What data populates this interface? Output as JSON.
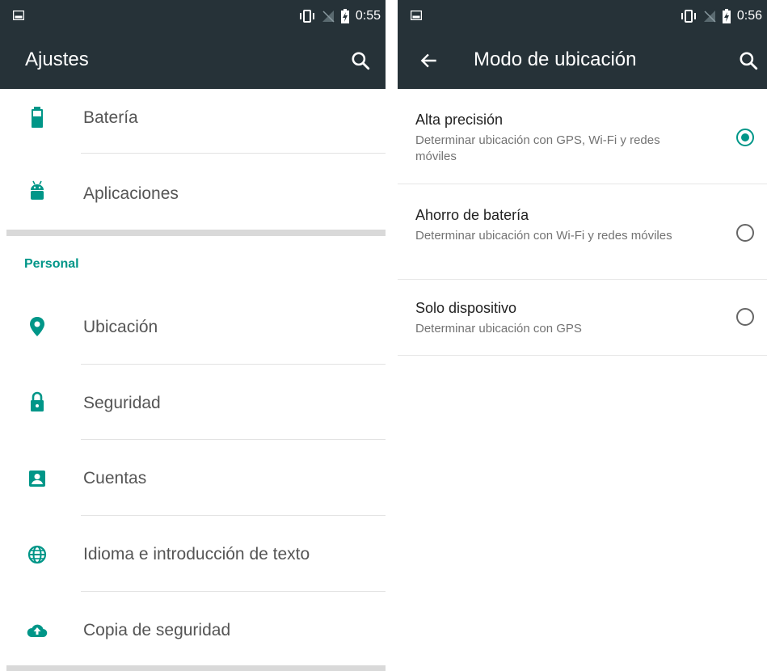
{
  "colors": {
    "toolbar": "#263238",
    "accent": "#009688",
    "icon": "#009688"
  },
  "left": {
    "status": {
      "time": "0:55"
    },
    "toolbar": {
      "title": "Ajustes",
      "search_icon": "search-icon"
    },
    "items_top": [
      {
        "label": "Batería",
        "icon": "battery-icon"
      },
      {
        "label": "Aplicaciones",
        "icon": "android-icon"
      }
    ],
    "section_header": "Personal",
    "items_personal": [
      {
        "label": "Ubicación",
        "icon": "location-pin-icon"
      },
      {
        "label": "Seguridad",
        "icon": "lock-icon"
      },
      {
        "label": "Cuentas",
        "icon": "account-box-icon"
      },
      {
        "label": "Idioma e introducción de texto",
        "icon": "globe-icon"
      },
      {
        "label": "Copia de seguridad",
        "icon": "cloud-upload-icon"
      }
    ]
  },
  "right": {
    "status": {
      "time": "0:56"
    },
    "toolbar": {
      "title": "Modo de ubicación",
      "back_icon": "arrow-back-icon",
      "search_icon": "search-icon"
    },
    "options": [
      {
        "title": "Alta precisión",
        "subtitle": "Determinar ubicación con GPS, Wi-Fi y redes móviles",
        "selected": true
      },
      {
        "title": "Ahorro de batería",
        "subtitle": "Determinar ubicación con Wi-Fi y redes móviles",
        "selected": false
      },
      {
        "title": "Solo dispositivo",
        "subtitle": "Determinar ubicación con GPS",
        "selected": false
      }
    ]
  }
}
